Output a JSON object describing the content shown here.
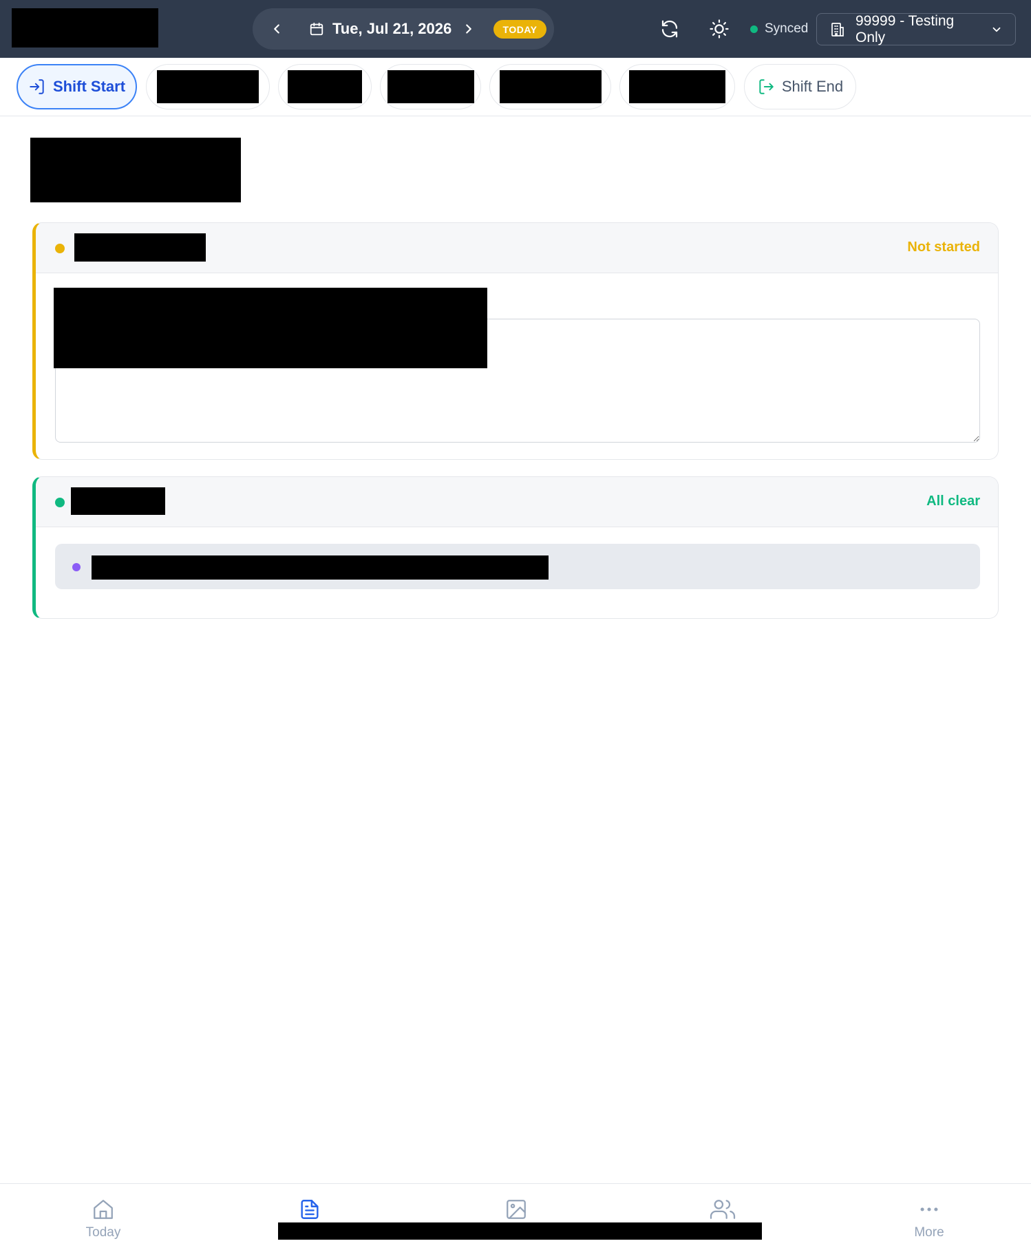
{
  "header": {
    "date_label": "Tue, Jul 21, 2026",
    "today_label": "TODAY",
    "sync_status": "Synced",
    "location": "99999 - Testing Only",
    "colors": {
      "bar": "#2f3a4c",
      "today_badge": "#eab308",
      "sync_dot": "#10b981"
    }
  },
  "tabs": {
    "shift_start": "Shift Start",
    "shift_end": "Shift End"
  },
  "cards": {
    "first": {
      "status": "Not started",
      "accent": "#eab308"
    },
    "second": {
      "status": "All clear",
      "accent": "#10b981"
    }
  },
  "bottom_nav": {
    "today": "Today",
    "more": "More"
  },
  "icons": [
    "chevron-left-icon",
    "calendar-icon",
    "chevron-right-icon",
    "refresh-icon",
    "sun-icon",
    "building-icon",
    "chevron-down-icon",
    "login-icon",
    "logout-icon",
    "home-icon",
    "document-icon",
    "image-icon",
    "users-icon",
    "more-icon"
  ]
}
